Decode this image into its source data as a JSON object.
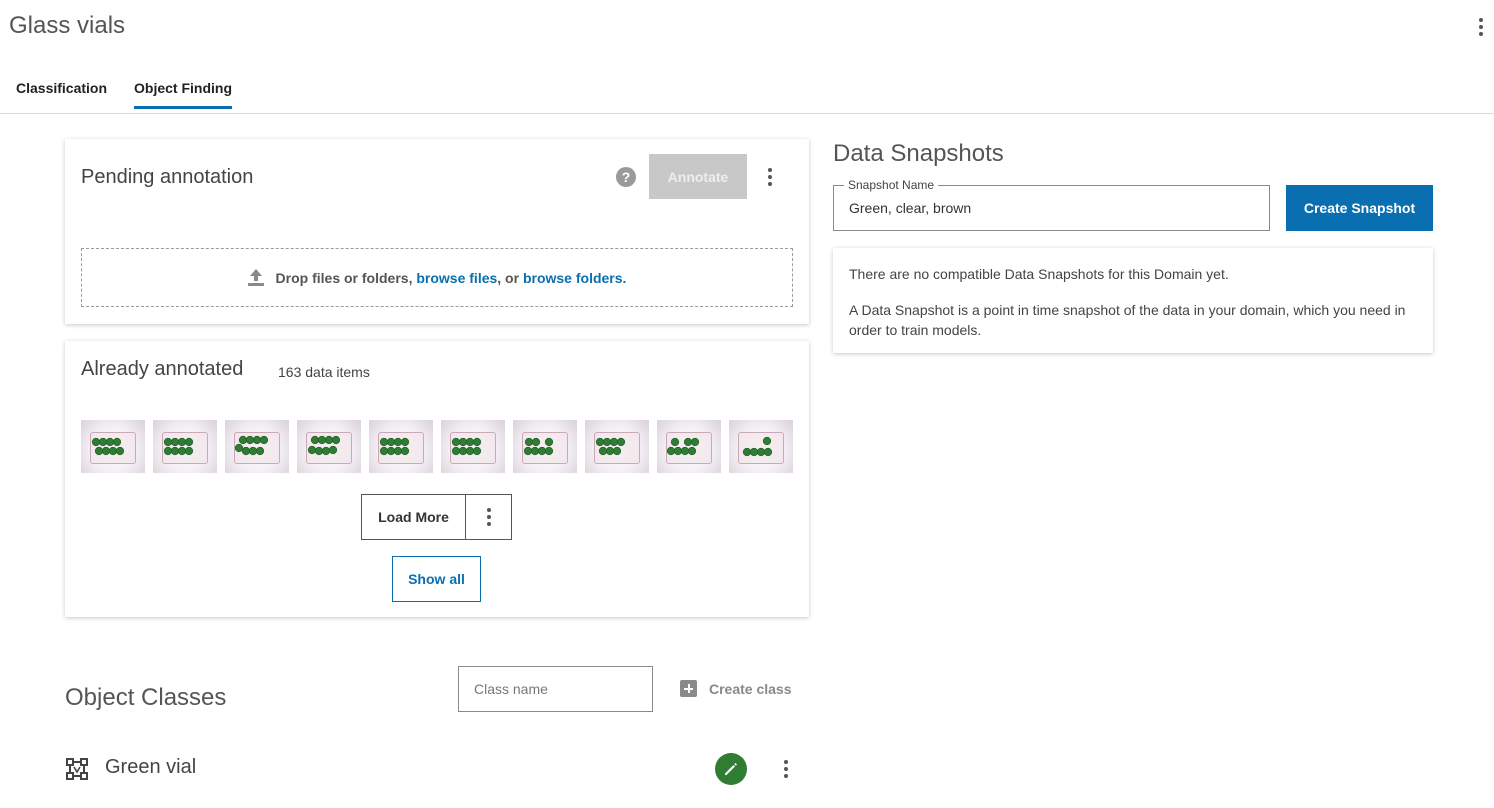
{
  "app": {
    "title": "Glass vials"
  },
  "tabs": [
    {
      "label": "Classification",
      "active": false
    },
    {
      "label": "Object Finding",
      "active": true
    }
  ],
  "pending": {
    "title": "Pending annotation",
    "help_icon": "help-circle-icon",
    "annotate_label": "Annotate",
    "annotate_disabled": true,
    "drop_text": "Drop files or folders, ",
    "browse_files": "browse files",
    "or_text": ", or ",
    "browse_folders": "browse folders",
    "drop_end": "."
  },
  "annotated": {
    "title": "Already annotated",
    "count": "163 data items",
    "thumbnail_count": 10,
    "load_more_label": "Load More",
    "show_all_label": "Show all"
  },
  "object_classes": {
    "title": "Object Classes",
    "class_name_placeholder": "Class name",
    "create_class_label": "Create class",
    "items": [
      {
        "label": "Green vial",
        "icon": "bounding-box-icon"
      }
    ]
  },
  "snapshots": {
    "title": "Data Snapshots",
    "name_label": "Snapshot Name",
    "name_value": "Green, clear, brown",
    "create_label": "Create Snapshot",
    "info_1": "There are no compatible Data Snapshots for this Domain yet.",
    "info_2": "A Data Snapshot is a point in time snapshot of the data in your domain, which you need in order to train models."
  },
  "colors": {
    "accent": "#0a6fb0",
    "edit_green": "#2e7d32",
    "disabled": "#c8c8c8",
    "vial_green": "#2f7d34"
  }
}
